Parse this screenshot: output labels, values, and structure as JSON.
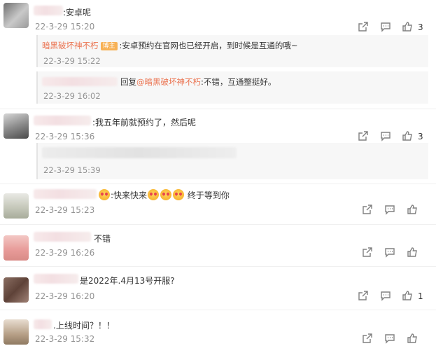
{
  "comments": [
    {
      "text": ":安卓呢",
      "time": "22-3-29 15:20",
      "like_count": "3",
      "replies": [
        {
          "author": "暗黑破坏神不朽",
          "badge": "博主",
          "text": ":安卓预约在官网也已经开启，到时候是互通的哦~",
          "time": "22-3-29 15:22"
        },
        {
          "prefix": "回复",
          "mention": "@暗黑破坏神不朽",
          "text": ":不错，互通整挺好。",
          "time": "22-3-29 16:02"
        }
      ]
    },
    {
      "text": ":我五年前就预约了，然后呢",
      "time": "22-3-29 15:36",
      "like_count": "3",
      "reply_time": "22-3-29 15:39"
    },
    {
      "text_a": ":快来快来",
      "text_b": "终于等到你",
      "time": "22-3-29 15:23",
      "like_count": ""
    },
    {
      "text": "不错",
      "time": "22-3-29 16:26",
      "like_count": ""
    },
    {
      "text": "是2022年.4月13号开服?",
      "time": "22-3-29 16:20",
      "like_count": "1"
    },
    {
      "text": ".上线时间？！！",
      "time": "22-3-29 15:32",
      "like_count": ""
    }
  ],
  "icons": {
    "share": "share-icon",
    "comment": "comment-icon",
    "like": "thumbs-up-icon"
  },
  "colors": {
    "accent": "#eb7350",
    "time": "#939393"
  }
}
